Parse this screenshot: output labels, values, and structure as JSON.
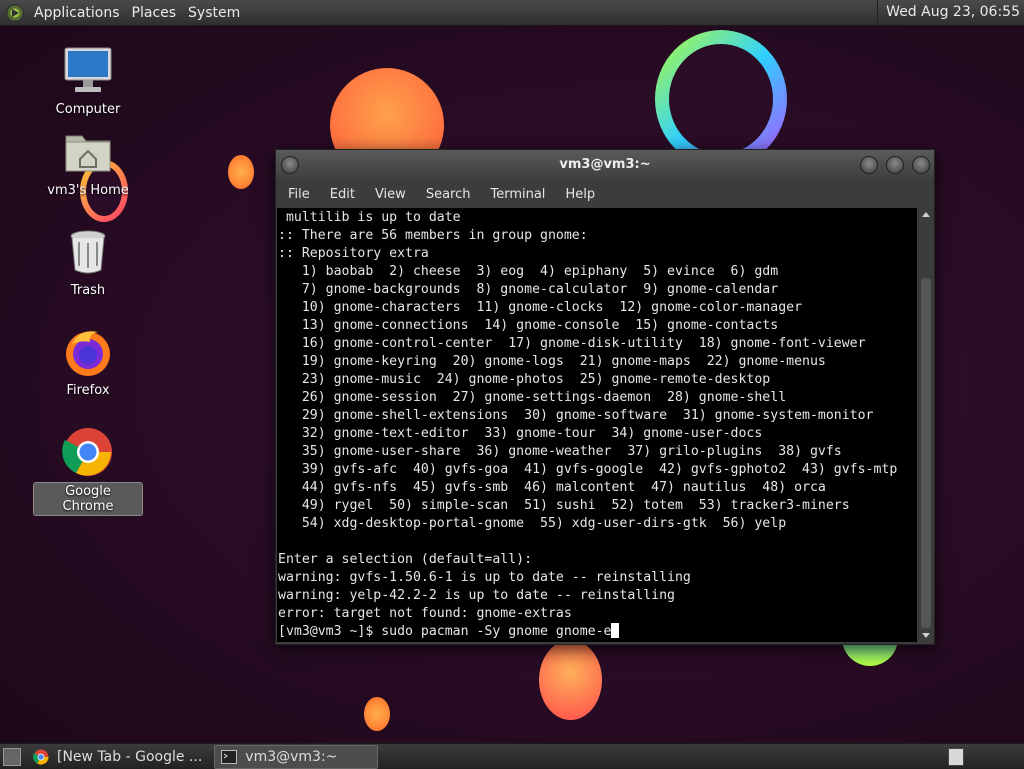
{
  "top_panel": {
    "menus": [
      "Applications",
      "Places",
      "System"
    ],
    "clock": "Wed Aug 23, 06:55"
  },
  "desktop_icons": [
    {
      "label": "Computer",
      "icon": "computer-icon"
    },
    {
      "label": "vm3's Home",
      "icon": "home-folder-icon"
    },
    {
      "label": "Trash",
      "icon": "trash-icon"
    },
    {
      "label": "Firefox",
      "icon": "firefox-icon"
    },
    {
      "label": "Google Chrome",
      "icon": "chrome-icon"
    }
  ],
  "terminal": {
    "title": "vm3@vm3:~",
    "menu": [
      "File",
      "Edit",
      "View",
      "Search",
      "Terminal",
      "Help"
    ],
    "lines": [
      " multilib is up to date",
      ":: There are 56 members in group gnome:",
      ":: Repository extra",
      "   1) baobab  2) cheese  3) eog  4) epiphany  5) evince  6) gdm",
      "   7) gnome-backgrounds  8) gnome-calculator  9) gnome-calendar",
      "   10) gnome-characters  11) gnome-clocks  12) gnome-color-manager",
      "   13) gnome-connections  14) gnome-console  15) gnome-contacts",
      "   16) gnome-control-center  17) gnome-disk-utility  18) gnome-font-viewer",
      "   19) gnome-keyring  20) gnome-logs  21) gnome-maps  22) gnome-menus",
      "   23) gnome-music  24) gnome-photos  25) gnome-remote-desktop",
      "   26) gnome-session  27) gnome-settings-daemon  28) gnome-shell",
      "   29) gnome-shell-extensions  30) gnome-software  31) gnome-system-monitor",
      "   32) gnome-text-editor  33) gnome-tour  34) gnome-user-docs",
      "   35) gnome-user-share  36) gnome-weather  37) grilo-plugins  38) gvfs",
      "   39) gvfs-afc  40) gvfs-goa  41) gvfs-google  42) gvfs-gphoto2  43) gvfs-mtp",
      "   44) gvfs-nfs  45) gvfs-smb  46) malcontent  47) nautilus  48) orca",
      "   49) rygel  50) simple-scan  51) sushi  52) totem  53) tracker3-miners",
      "   54) xdg-desktop-portal-gnome  55) xdg-user-dirs-gtk  56) yelp",
      "",
      "Enter a selection (default=all):",
      "warning: gvfs-1.50.6-1 is up to date -- reinstalling",
      "warning: yelp-42.2-2 is up to date -- reinstalling",
      "error: target not found: gnome-extras"
    ],
    "prompt": "[vm3@vm3 ~]$ sudo pacman -Sy gnome gnome-e"
  },
  "taskbar": {
    "tasks": [
      {
        "label": "[New Tab - Google ...",
        "icon": "chrome-icon",
        "active": false
      },
      {
        "label": "vm3@vm3:~",
        "icon": "terminal-icon",
        "active": true
      }
    ]
  }
}
